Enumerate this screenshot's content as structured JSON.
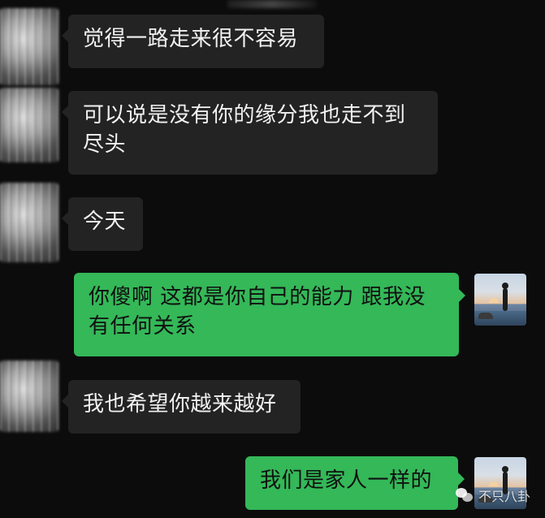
{
  "chat": {
    "messages": [
      {
        "side": "left",
        "text": "觉得一路走来很不容易"
      },
      {
        "side": "left",
        "text": "可以说是没有你的缘分我也走不到尽头"
      },
      {
        "side": "left",
        "text": "今天"
      },
      {
        "side": "right",
        "text": "你傻啊 这都是你自己的能力 跟我没有任何关系"
      },
      {
        "side": "left",
        "text": "我也希望你越来越好"
      },
      {
        "side": "right",
        "text": "我们是家人一样的"
      }
    ]
  },
  "watermark": {
    "icon": "wechat-icon",
    "text": "不只八卦"
  },
  "colors": {
    "background": "#0c0c0c",
    "left_bubble": "#232323",
    "right_bubble": "#34b858"
  }
}
